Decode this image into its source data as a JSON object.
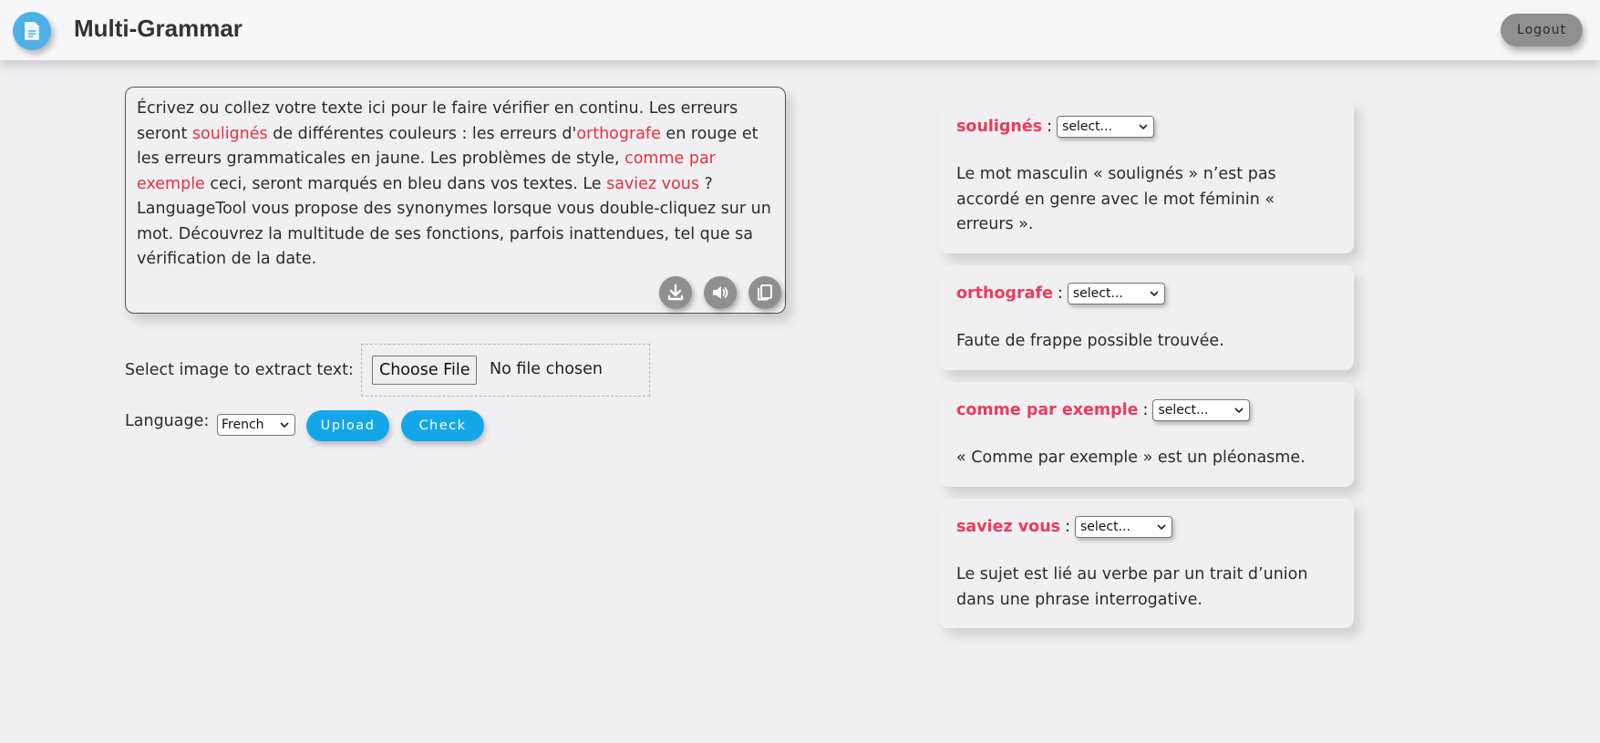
{
  "app": {
    "title": "Multi-Grammar",
    "logout_label": "Logout"
  },
  "editor": {
    "segments": [
      {
        "text": "Écrivez ou collez votre texte ici pour le faire vérifier en continu. Les erreurs seront ",
        "error": false
      },
      {
        "text": "soulignés",
        "error": true
      },
      {
        "text": " de différentes couleurs : les erreurs d'",
        "error": false
      },
      {
        "text": "orthografe",
        "error": true
      },
      {
        "text": " en rouge et les erreurs grammaticales en jaune. Les problèmes de style, ",
        "error": false
      },
      {
        "text": "comme par exemple",
        "error": true
      },
      {
        "text": " ceci, seront marqués en bleu dans vos textes. Le ",
        "error": false
      },
      {
        "text": "saviez vous",
        "error": true
      },
      {
        "text": " ? LanguageTool vous propose des synonymes lorsque vous double-cliquez sur un mot. Découvrez la multitude de ses fonctions, parfois inattendues, tel que sa vérification de la date.",
        "error": false
      }
    ],
    "tools": [
      "download-icon",
      "speaker-icon",
      "copy-icon"
    ]
  },
  "image_extract": {
    "label": "Select image to extract text:",
    "choose_file_label": "Choose File",
    "file_status": "No file chosen"
  },
  "language": {
    "label": "Language:",
    "selected": "French",
    "upload_label": "Upload",
    "check_label": "Check"
  },
  "suggestions": [
    {
      "word": "soulignés",
      "select_value": "select...",
      "message": "Le mot masculin « soulignés » n’est pas accordé en genre avec le mot féminin « erreurs »."
    },
    {
      "word": "orthografe",
      "select_value": "select...",
      "message": "Faute de frappe possible trouvée."
    },
    {
      "word": "comme par exemple",
      "select_value": "select...",
      "message": "« Comme par exemple » est un pléonasme."
    },
    {
      "word": "saviez vous",
      "select_value": "select...",
      "message": "Le sujet est lié au verbe par un trait d’union dans une phrase interrogative."
    }
  ],
  "colors": {
    "error_text": "#ee2d3c",
    "suggestion_word": "#ee3a5b",
    "button_blue": "#13a7ea",
    "logo_blue": "#4db1e6",
    "icon_button_gray": "#8f8f92",
    "background": "#f0f0f3"
  }
}
